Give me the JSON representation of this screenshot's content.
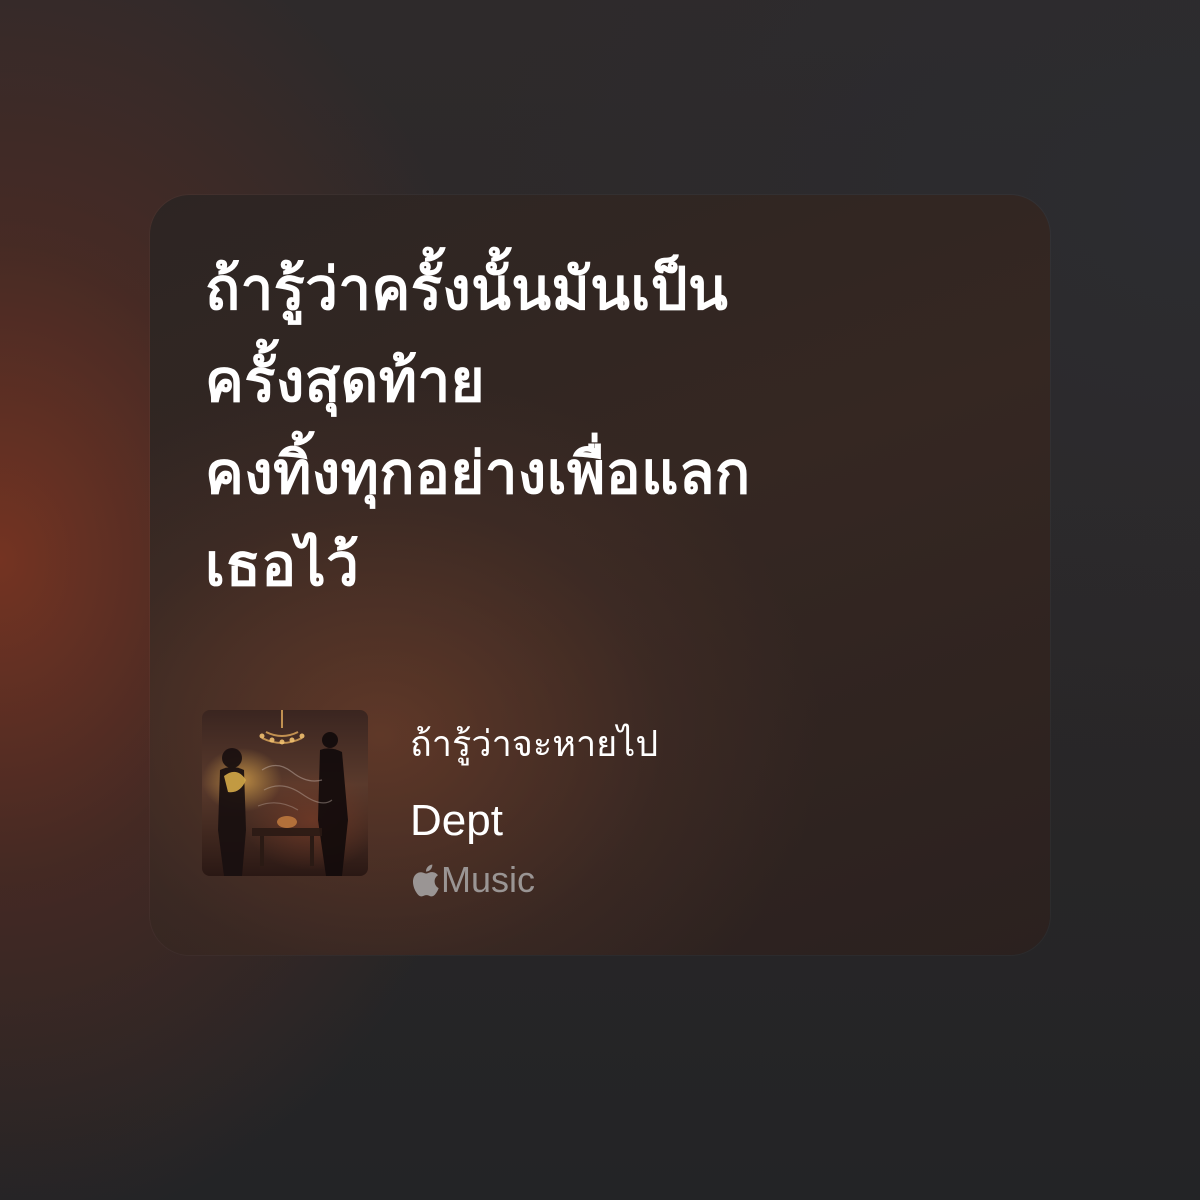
{
  "lyrics": {
    "lines": [
      "ถ้ารู้ว่าครั้งนั้นมันเป็น",
      "ครั้งสุดท้าย",
      "คงทิ้งทุกอย่างเพื่อแลก",
      "เธอไว้"
    ]
  },
  "song": {
    "title": "ถ้ารู้ว่าจะหายไป",
    "artist": "Dept",
    "service_label": "Music",
    "service_icon": "apple-logo-icon"
  },
  "colors": {
    "lyrics_text": "#ffffff",
    "service_text": "#9a9594",
    "accent_warm": "#7a3a26"
  }
}
